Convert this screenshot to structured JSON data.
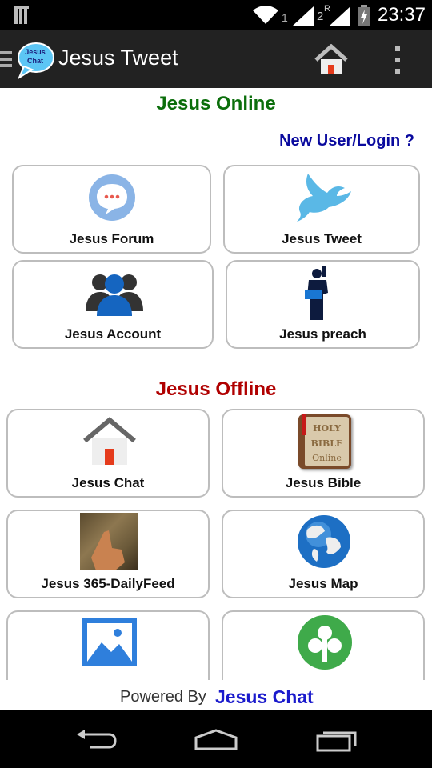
{
  "status_bar": {
    "sim1_label": "1",
    "sim2_label": "2",
    "roaming_label": "R",
    "time": "23:37"
  },
  "app_bar": {
    "logo_text_1": "Jesus",
    "logo_text_2": "Chat",
    "title": "Jesus Tweet"
  },
  "online": {
    "title": "Jesus Online",
    "title_color": "#0b6e0b",
    "login_link": "New User/Login ?",
    "tiles": [
      {
        "label": "Jesus Forum"
      },
      {
        "label": "Jesus Tweet"
      },
      {
        "label": "Jesus Account"
      },
      {
        "label": "Jesus preach"
      }
    ]
  },
  "offline": {
    "title": "Jesus Offline",
    "title_color": "#b00000",
    "tiles": [
      {
        "label": "Jesus Chat"
      },
      {
        "label": "Jesus Bible",
        "book_text_1": "HOLY",
        "book_text_2": "BIBLE",
        "book_text_3": "Online"
      },
      {
        "label": "Jesus 365-DailyFeed"
      },
      {
        "label": "Jesus Map"
      },
      {
        "label": ""
      },
      {
        "label": ""
      }
    ]
  },
  "footer": {
    "prefix": "Powered By",
    "brand": "Jesus Chat"
  },
  "colors": {
    "link_blue": "#0a0a9e",
    "brand_blue": "#1a1acc"
  }
}
